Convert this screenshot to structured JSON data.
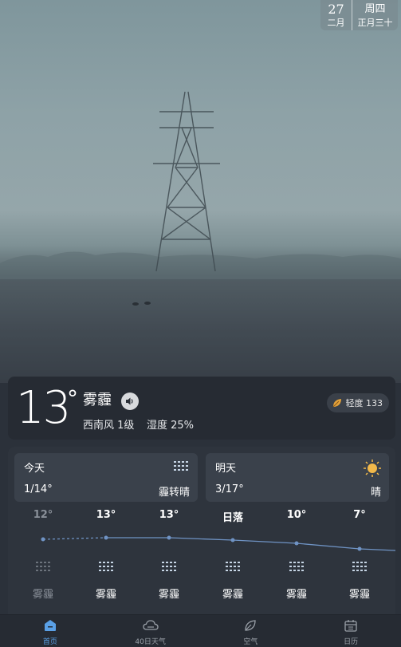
{
  "date": {
    "day": "27",
    "month": "二月",
    "weekday": "周四",
    "lunar": "正月三十"
  },
  "current": {
    "temp": "13",
    "degree": "°",
    "condition": "雾霾",
    "wind": "西南风 1级",
    "humidity": "湿度 25%",
    "aqi_label": "轻度 133"
  },
  "today": {
    "name": "今天",
    "range": "1/14°",
    "condition": "霾转晴",
    "icon": "haze-icon"
  },
  "tomorrow": {
    "name": "明天",
    "range": "3/17°",
    "condition": "晴",
    "icon": "sun-icon"
  },
  "hourly": [
    {
      "temp": "12°",
      "condition": "雾霾",
      "past": true
    },
    {
      "temp": "13°",
      "condition": "雾霾",
      "past": false
    },
    {
      "temp": "13°",
      "condition": "雾霾",
      "past": false
    },
    {
      "temp": "日落",
      "condition": "雾霾",
      "past": false
    },
    {
      "temp": "10°",
      "condition": "雾霾",
      "past": false
    },
    {
      "temp": "7°",
      "condition": "雾霾",
      "past": false
    }
  ],
  "nav": [
    {
      "label": "首页",
      "icon": "home-icon",
      "active": true
    },
    {
      "label": "40日天气",
      "icon": "cloud-icon",
      "active": false
    },
    {
      "label": "空气",
      "icon": "leaf-icon",
      "active": false
    },
    {
      "label": "日历",
      "icon": "calendar-icon",
      "active": false
    }
  ],
  "colors": {
    "accent": "#5aa0e6",
    "card": "#262b33",
    "panel": "#2e343d",
    "line": "#6f93c4"
  }
}
